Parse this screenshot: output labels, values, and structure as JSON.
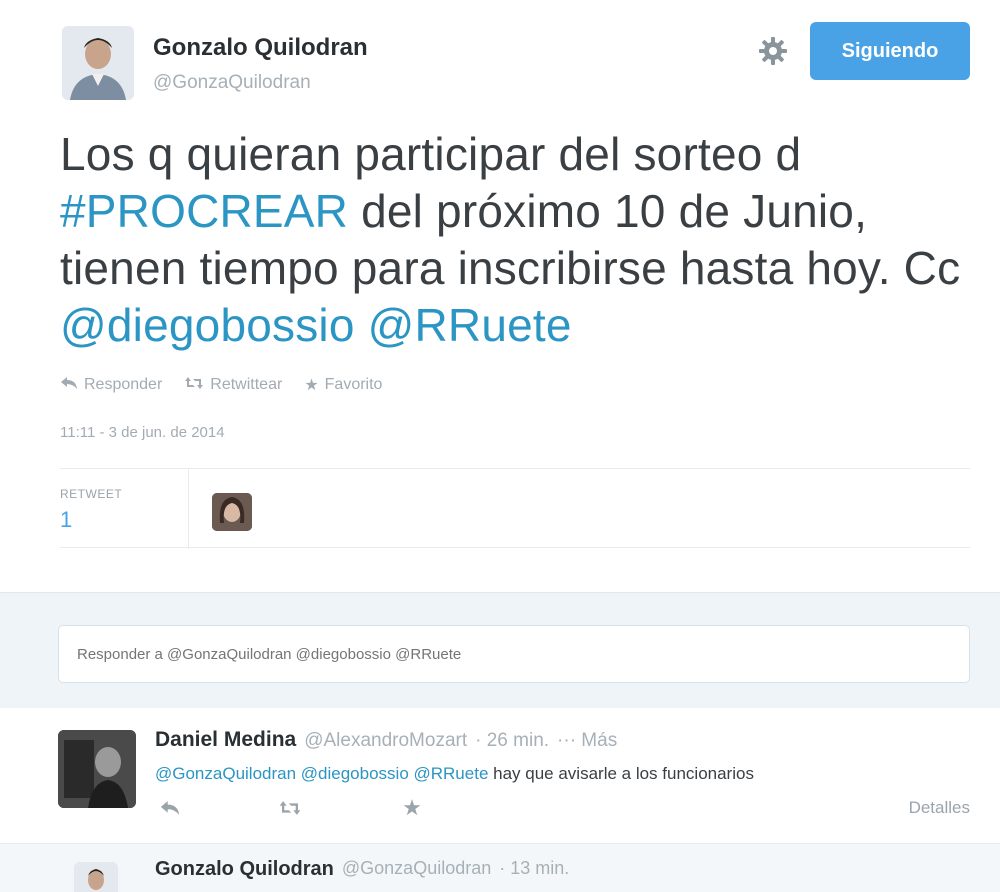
{
  "tweet": {
    "author_name": "Gonzalo Quilodran",
    "author_handle": "@GonzaQuilodran",
    "follow_label": "Siguiendo",
    "text_parts": [
      "Los q quieran participar del sorteo d ",
      "#PROCREAR",
      " del próximo 10 de Junio, tienen tiempo para inscribirse hasta hoy. Cc ",
      "@diegobossio",
      " ",
      "@RRuete"
    ],
    "actions": {
      "reply": "Responder",
      "retweet": "Retwittear",
      "favorite": "Favorito"
    },
    "timestamp": "11:11 - 3 de jun. de 2014",
    "stats": {
      "retweet_label": "RETWEET",
      "retweet_count": "1"
    }
  },
  "reply_box": {
    "placeholder": "Responder a @GonzaQuilodran @diegobossio @RRuete"
  },
  "reply": {
    "name": "Daniel Medina",
    "handle": "@AlexandroMozart",
    "time": "· 26 min.",
    "more": "··· Más",
    "text_links": "@GonzaQuilodran @diegobossio @RRuete",
    "text_rest": " hay que avisarle a los funcionarios",
    "details": "Detalles"
  },
  "next_tweet": {
    "name": "Gonzalo Quilodran",
    "handle": "@GonzaQuilodran",
    "time": "· 13 min."
  },
  "icons": {
    "settings": "gear-icon",
    "reply": "reply-icon",
    "retweet": "retweet-icon",
    "favorite": "star-icon"
  },
  "colors": {
    "follow_button": "#4aa2e6",
    "link": "#2b95c4",
    "reply_zone_bg": "#eef4f8"
  }
}
